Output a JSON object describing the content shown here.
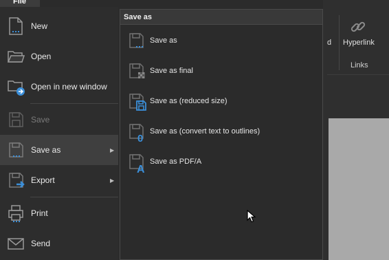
{
  "file_tab": {
    "label": "File"
  },
  "left_menu": {
    "items": [
      {
        "label": "New",
        "icon": "new-document-icon",
        "enabled": true
      },
      {
        "label": "Open",
        "icon": "folder-open-icon",
        "enabled": true
      },
      {
        "label": "Open in new window",
        "icon": "folder-new-window-icon",
        "enabled": true
      },
      {
        "label": "Save",
        "icon": "save-icon",
        "enabled": false
      },
      {
        "label": "Save as",
        "icon": "save-as-icon",
        "enabled": true,
        "submenu": true,
        "selected": true
      },
      {
        "label": "Export",
        "icon": "export-icon",
        "enabled": true,
        "submenu": true
      },
      {
        "label": "Print",
        "icon": "print-icon",
        "enabled": true
      },
      {
        "label": "Send",
        "icon": "send-mail-icon",
        "enabled": true
      }
    ]
  },
  "submenu": {
    "title": "Save as",
    "items": [
      {
        "label": "Save as",
        "icon": "save-as-icon"
      },
      {
        "label": "Save as final",
        "icon": "save-as-final-icon"
      },
      {
        "label": "Save as (reduced size)",
        "icon": "save-reduced-size-icon"
      },
      {
        "label": "Save as (convert text to outlines)",
        "icon": "save-outlines-icon"
      },
      {
        "label": "Save as PDF/A",
        "icon": "save-pdfa-icon"
      }
    ]
  },
  "ribbon": {
    "partial_label": "d",
    "hyperlink_label": "Hyperlink",
    "group_label": "Links"
  },
  "colors": {
    "accent_blue": "#3b8fd9",
    "menu_bg": "#2d2d2d",
    "selected_bg": "#3f3f3f",
    "disabled_text": "#7a7a7a"
  }
}
